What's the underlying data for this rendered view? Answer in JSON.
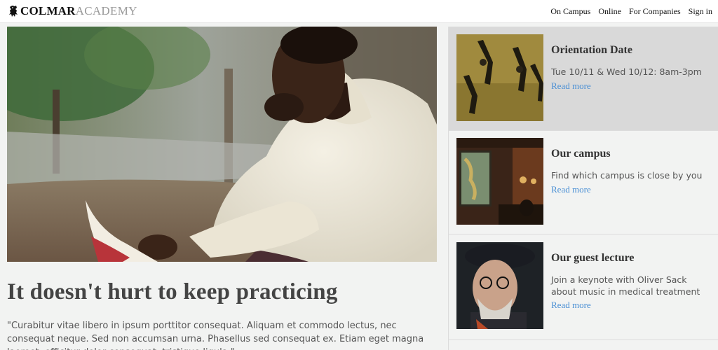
{
  "header": {
    "logo_strong": "COLMAR",
    "logo_light": "ACADEMY",
    "nav": [
      "On Campus",
      "Online",
      "For Companies",
      "Sign in"
    ]
  },
  "hero": {
    "image": "man-reading-book-outdoors",
    "headline": "It doesn't hurt to keep practicing",
    "quote": "\"Curabitur vitae libero in ipsum porttitor consequat. Aliquam et commodo lectus, nec consequat neque. Sed non accumsan urna. Phasellus sed consequat ex. Etiam eget magna laoreet, efficitur dolor consequat, tristique ligula.\""
  },
  "cards": [
    {
      "image": "people-walking-shadows",
      "title": "Orientation Date",
      "description": "Tue 10/11 & Wed 10/12: 8am-3pm",
      "link": "Read more"
    },
    {
      "image": "campus-cafe-interior",
      "title": "Our campus",
      "description": "Find which campus is close by you",
      "link": "Read more"
    },
    {
      "image": "older-man-with-cap-portrait",
      "title": "Our guest lecture",
      "description": "Join a keynote with Oliver Sack about music in medical treatment",
      "link": "Read more"
    }
  ],
  "colors": {
    "accent_link": "#4a8fd4",
    "active_card": "#d9d9d9",
    "page_bg": "#f2f3f2"
  }
}
